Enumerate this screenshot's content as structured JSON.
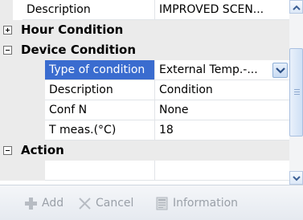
{
  "grid": {
    "top_row": {
      "name": "Description",
      "value": "IMPROVED SCEN..."
    },
    "categories": [
      {
        "label": "Hour Condition",
        "expanded": false
      },
      {
        "label": "Device Condition",
        "expanded": true
      },
      {
        "label": "Action",
        "expanded": true
      }
    ],
    "device_rows": [
      {
        "name": "Type of condition",
        "value": "External Temp.-..."
      },
      {
        "name": "Description",
        "value": "Condition"
      },
      {
        "name": "Conf N",
        "value": "None"
      },
      {
        "name": "T meas.(°C)",
        "value": "18"
      }
    ],
    "selected_row": "Type of condition",
    "selection_color": "#3a6ccf"
  },
  "toolbar": {
    "add_label": "Add",
    "cancel_label": "Cancel",
    "information_label": "Information",
    "enabled": false
  },
  "icons": {
    "expand": "plus-box-icon",
    "collapse": "minus-box-icon",
    "dropdown": "chevron-down-icon",
    "add": "plus-icon",
    "cancel": "x-icon",
    "information": "info-icon"
  }
}
